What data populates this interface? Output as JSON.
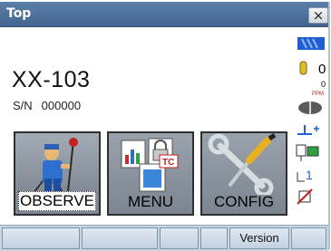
{
  "window": {
    "title": "Top",
    "close_label": "×"
  },
  "instrument": {
    "model": "XX-103",
    "serial_label": "S/N",
    "serial_number": "000000"
  },
  "apps": [
    {
      "label": "OBSERVE",
      "icon": "surveyor-icon",
      "selected": true
    },
    {
      "label": "MENU",
      "icon": "menu-documents-icon",
      "selected": false
    },
    {
      "label": "CONFIG",
      "icon": "wrench-screwdriver-icon",
      "selected": false
    }
  ],
  "status": {
    "atm_value": "0",
    "ppm_label": "PPM"
  },
  "softkeys": [
    "",
    "",
    "",
    "",
    "Version",
    ""
  ],
  "colors": {
    "titlebar": "#4a6e96",
    "softkey_bar": "#c9d6e4",
    "accent_blue": "#1f5fd1"
  }
}
